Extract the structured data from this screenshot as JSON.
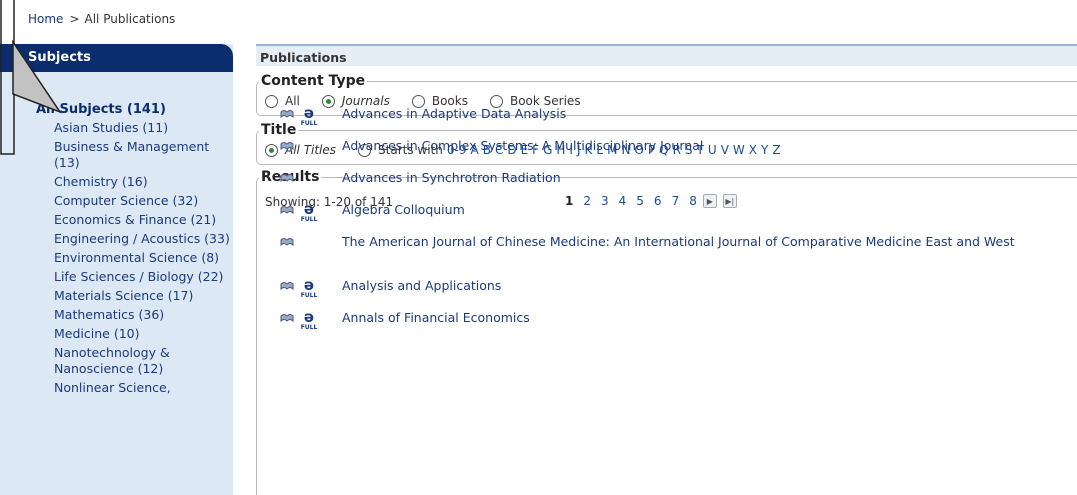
{
  "breadcrumb": {
    "home": "Home",
    "sep": ">",
    "current": "All Publications"
  },
  "sidebar": {
    "title": "Subjects",
    "all": "All Subjects (141)",
    "items": [
      "Asian Studies (11)",
      "Business & Management (13)",
      "Chemistry (16)",
      "Computer Science (32)",
      "Economics & Finance (21)",
      "Engineering / Acoustics (33)",
      "Environmental Science (8)",
      "Life Sciences / Biology (22)",
      "Materials Science (17)",
      "Mathematics (36)",
      "Medicine (10)",
      "Nanotechnology & Nanoscience (12)",
      "Nonlinear Science,"
    ]
  },
  "main": {
    "title": "Publications",
    "content_type": {
      "legend": "Content Type",
      "options": [
        "All",
        "Journals",
        "Books",
        "Book Series"
      ],
      "selected": "Journals"
    },
    "title_filter": {
      "legend": "Title",
      "all_titles": "All Titles",
      "starts_with": "Starts with",
      "letters": [
        "0-9",
        "A",
        "B",
        "C",
        "D",
        "E",
        "F",
        "G",
        "H",
        "I",
        "J",
        "K",
        "L",
        "M",
        "N",
        "O",
        "P",
        "Q",
        "R",
        "S",
        "T",
        "U",
        "V",
        "W",
        "X",
        "Y",
        "Z"
      ]
    },
    "results": {
      "legend": "Results",
      "showing": "Showing: 1-20 of 141",
      "pages": [
        "1",
        "2",
        "3",
        "4",
        "5",
        "6",
        "7",
        "8"
      ],
      "current_page": "1",
      "oa_label": "FULL",
      "items": [
        {
          "title": "Advances in Adaptive Data Analysis",
          "open_access": true
        },
        {
          "title": "Advances in Complex Systems: A Multidisciplinary Journal",
          "open_access": false
        },
        {
          "title": "Advances in Synchrotron Radiation",
          "open_access": false
        },
        {
          "title": "Algebra Colloquium",
          "open_access": true
        },
        {
          "title": "The American Journal of Chinese Medicine: An International Journal of Comparative Medicine East and West",
          "open_access": false
        },
        {
          "title": "Analysis and Applications",
          "open_access": true
        },
        {
          "title": "Annals of Financial Economics",
          "open_access": true
        }
      ]
    }
  },
  "colors": {
    "sidebar_header": "#0b2d6e",
    "sidebar_bg": "#dde8f5",
    "link": "#1a3a7a",
    "radio_on": "#2f8c2f"
  }
}
